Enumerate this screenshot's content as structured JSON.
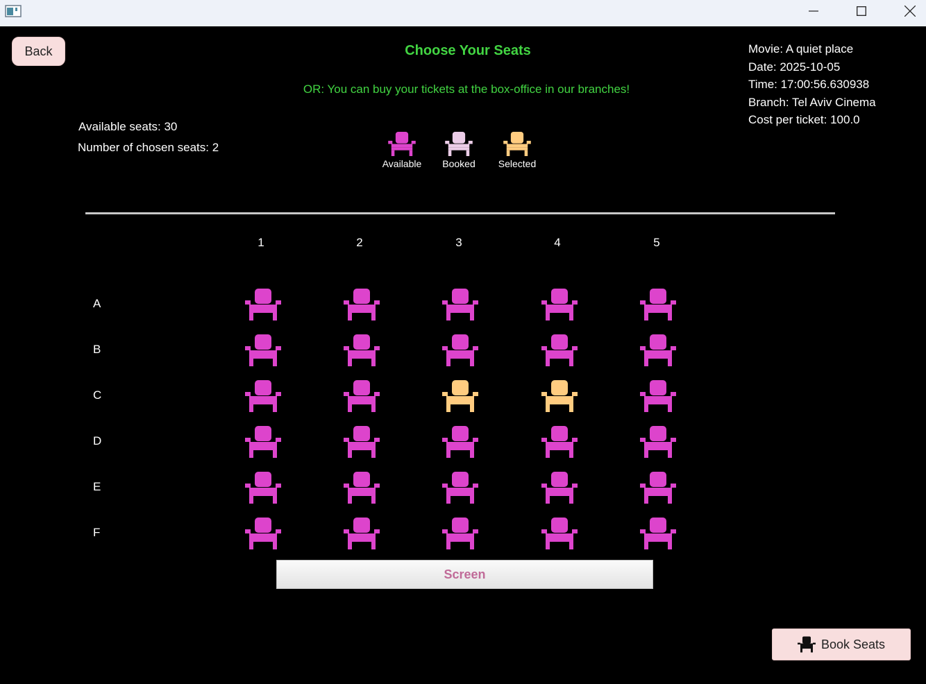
{
  "window": {
    "icon": "app-window-icon"
  },
  "header": {
    "back_label": "Back",
    "title": "Choose Your Seats",
    "subtitle": "OR: You can buy your tickets at the box-office in our branches!"
  },
  "info": {
    "movie": "Movie: A quiet place",
    "date": "Date: 2025-10-05",
    "time": "Time: 17:00:56.630938",
    "branch": "Branch: Tel Aviv Cinema",
    "cost": "Cost per ticket: 100.0"
  },
  "stats": {
    "available": "Available seats: 30",
    "chosen": "Number of chosen seats: 2"
  },
  "legend": [
    {
      "label": "Available",
      "status": "available"
    },
    {
      "label": "Booked",
      "status": "booked"
    },
    {
      "label": "Selected",
      "status": "selected"
    }
  ],
  "colors": {
    "available": "#dd44cc",
    "booked": "#eccde8",
    "selected": "#ffcc80",
    "heading": "#42d442"
  },
  "columns": [
    "1",
    "2",
    "3",
    "4",
    "5"
  ],
  "rows": [
    {
      "label": "A",
      "seats": [
        "available",
        "available",
        "available",
        "available",
        "available"
      ]
    },
    {
      "label": "B",
      "seats": [
        "available",
        "available",
        "available",
        "available",
        "available"
      ]
    },
    {
      "label": "C",
      "seats": [
        "available",
        "available",
        "selected",
        "selected",
        "available"
      ]
    },
    {
      "label": "D",
      "seats": [
        "available",
        "available",
        "available",
        "available",
        "available"
      ]
    },
    {
      "label": "E",
      "seats": [
        "available",
        "available",
        "available",
        "available",
        "available"
      ]
    },
    {
      "label": "F",
      "seats": [
        "available",
        "available",
        "available",
        "available",
        "available"
      ]
    }
  ],
  "screen_label": "Screen",
  "book_button": {
    "label": "Book Seats",
    "icon": "seat-icon"
  }
}
